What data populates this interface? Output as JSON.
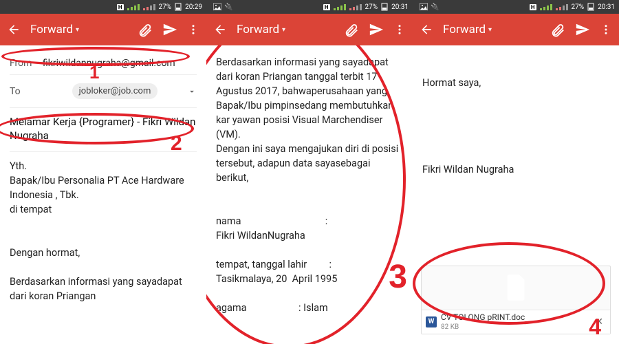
{
  "status": {
    "battery": "27%",
    "time1": "20:29",
    "time2": "20:31",
    "time3": "20:31",
    "net_badge": "H"
  },
  "appbar": {
    "back_icon": "←",
    "title": "Forward",
    "dropdown_icon": "▾",
    "attach_icon": "attach",
    "send_icon": "send",
    "more_icon": "⋮"
  },
  "compose": {
    "from_label": "From",
    "from_value": "fikriwildannugraha@gmail.com",
    "to_label": "To",
    "to_value": "jobloker@job.com",
    "expand_icon": "⌄",
    "subject": "Melamar Kerja {Programer} - Fikri Wildan Nugraha"
  },
  "body1": "Yth.\nBapak/Ibu Personalia PT Ace Hardware Indonesia , Tbk.\ndi tempat\n\n\nDengan hormat,\n\nBerdasarkan informasi yang sayadapat dari koran Priangan",
  "body2": "Berdasarkan informasi yang sayadapat dari koran Priangan tanggal terbit 17 Agustus 2017, bahwaperusahaan yang Bapak/Ibu pimpinsedang membutuhkan kar yawan posisi Visual Marchendiser (VM).\nDengan ini saya mengajukan diri di posisi tersebut, adapun data sayasebagai berikut,\n\n\nnama                                  :\nFikri WildanNugraha\n\ntempat, tanggal lahir         :\nTasikmalaya, 20  April 1995\n\nagama                     : Islam",
  "body3": "Hormat saya,\n\n\n\n\n\nFikri Wildan Nugraha",
  "attachment": {
    "name": "CV TOLONG pRINT.doc",
    "size": "82 KB",
    "type_badge": "W",
    "close": "✕"
  },
  "annotations": {
    "n1": "1",
    "n2": "2",
    "n3": "3",
    "n4": "4"
  }
}
